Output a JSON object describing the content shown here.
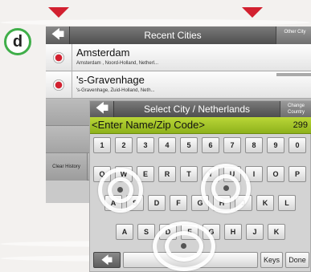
{
  "figure_label": "d",
  "recent": {
    "title": "Recent Cities",
    "other_city": "Other City",
    "back_icon": "arrow-left-icon",
    "items": [
      {
        "city": "Amsterdam",
        "detail": "Amsterdam , Noord-Holland, Netherl..."
      },
      {
        "city": "'s-Gravenhage",
        "detail": "'s-Gravenhage, Zuid-Holland, Neth..."
      }
    ],
    "clear_history": "Clear History"
  },
  "select": {
    "title": "Select City / Netherlands",
    "change_country": "Change Country",
    "back_icon": "arrow-left-icon"
  },
  "entry": {
    "placeholder": "<Enter Name/Zip Code>",
    "count": "299"
  },
  "keyboard": {
    "row1": [
      "1",
      "2",
      "3",
      "4",
      "5",
      "6",
      "7",
      "8",
      "9",
      "0"
    ],
    "row2": [
      "Q",
      "W",
      "E",
      "R",
      "T",
      "Y",
      "U",
      "I",
      "O",
      "P"
    ],
    "row3": [
      "A",
      "S",
      "D",
      "F",
      "G",
      "H",
      "J",
      "K",
      "L"
    ],
    "row4": [
      "A",
      "S",
      "D",
      "F",
      "G",
      "H",
      "J",
      "K"
    ],
    "keys_label": "Keys",
    "done_label": "Done",
    "backspace_icon": "backspace-arrow-icon"
  },
  "colors": {
    "marker": "#d2202f",
    "badge_ring": "#3fae49",
    "entry_bar": "#a6c62a"
  }
}
